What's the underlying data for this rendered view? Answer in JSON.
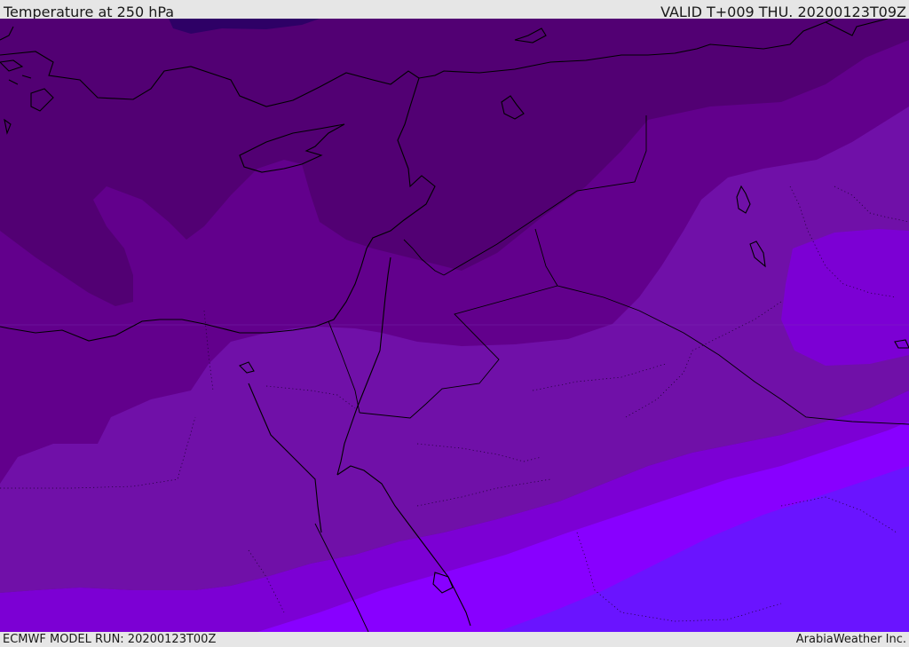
{
  "header": {
    "title": "Temperature at 250 hPa",
    "valid": "VALID T+009 THU. 20200123T09Z"
  },
  "footer": {
    "model_run": "ECMWF MODEL RUN: 20200123T00Z",
    "credit": "ArabiaWeather Inc."
  },
  "map": {
    "field": "temperature-250hpa",
    "colors": {
      "coldest": "#2e0066",
      "band1": "#520073",
      "band2": "#62008c",
      "band3": "#7010a8",
      "band4": "#7c00d4",
      "band5": "#8800ff",
      "band6": "#6a14ff",
      "coastline": "#000000"
    }
  }
}
